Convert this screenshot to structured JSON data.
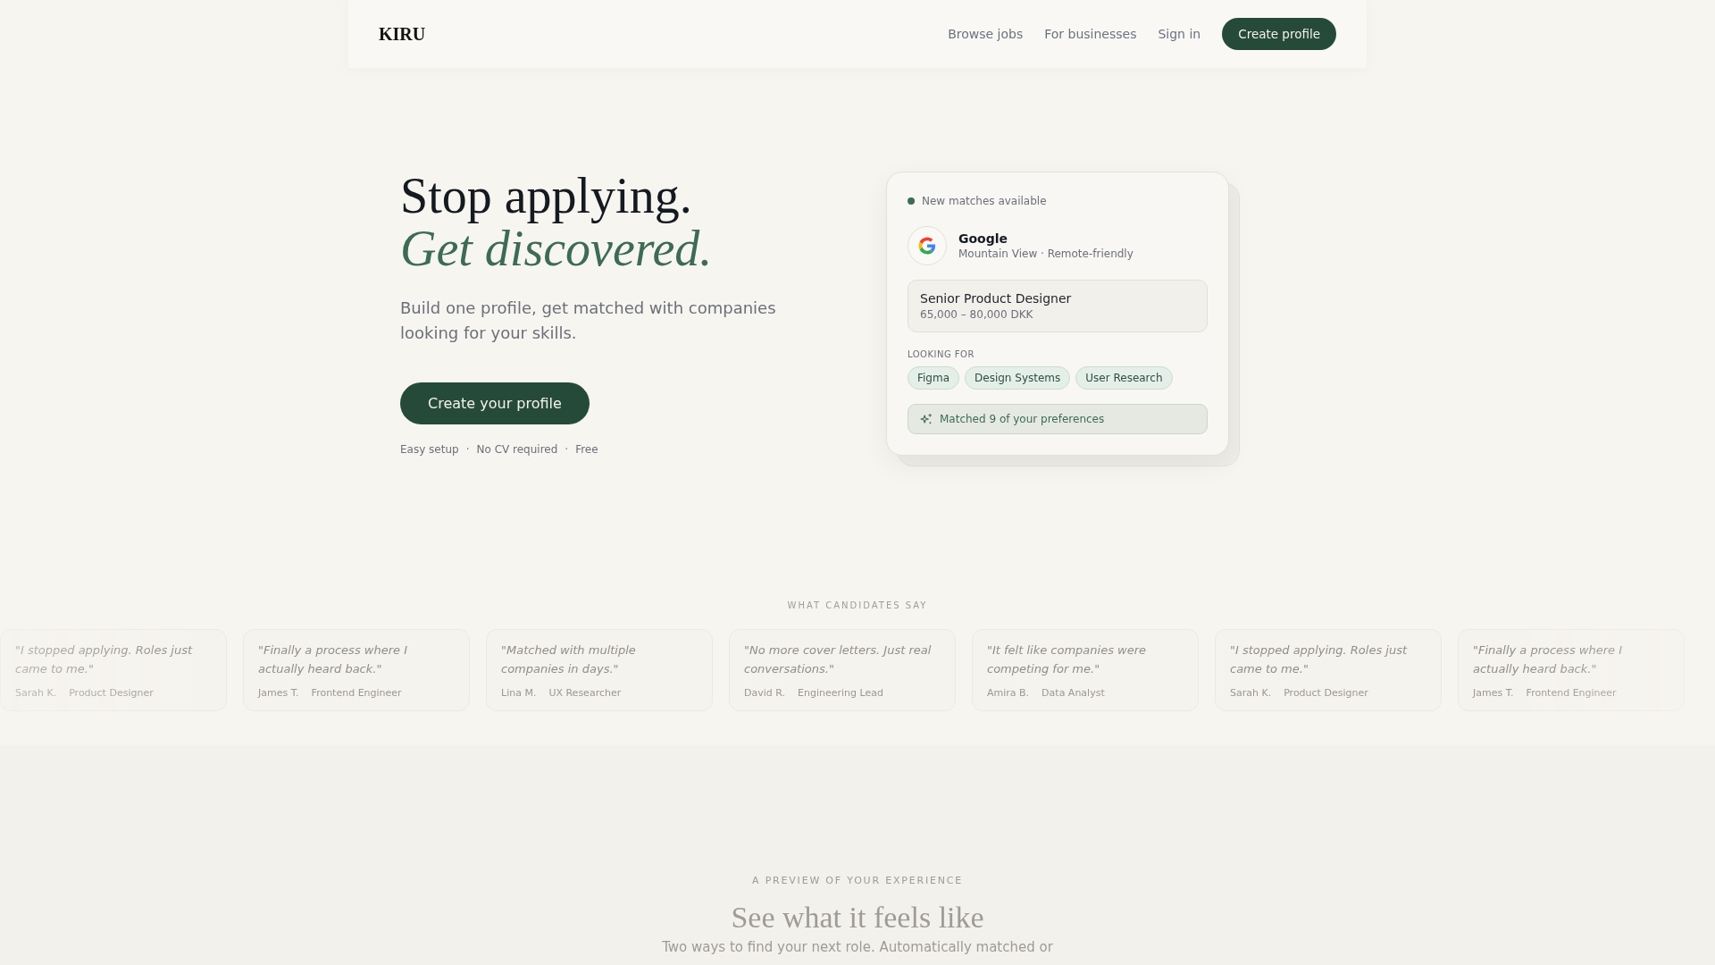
{
  "nav": {
    "logo": "KIRU",
    "links": [
      "Browse jobs",
      "For businesses",
      "Sign in"
    ],
    "cta": "Create profile"
  },
  "hero": {
    "title_line": "Stop applying.",
    "title_accent": "Get discovered.",
    "subtitle": "Build one profile, get matched with companies looking for your skills.",
    "cta": "Create your profile",
    "features": [
      "Easy setup",
      "No CV required",
      "Free"
    ],
    "separator": "·"
  },
  "match_card": {
    "status": "New matches available",
    "company": "Google",
    "location": "Mountain View · Remote-friendly",
    "job_title": "Senior Product Designer",
    "salary": "65,000 – 80,000 DKK",
    "looking_for_label": "LOOKING FOR",
    "tags": [
      "Figma",
      "Design Systems",
      "User Research"
    ],
    "match_summary": "Matched 9 of your preferences"
  },
  "testimonials": {
    "label": "WHAT CANDIDATES SAY",
    "items": [
      {
        "quote": "\"I stopped applying. Roles just came to me.\"",
        "name": "Sarah K.",
        "role": "Product Designer"
      },
      {
        "quote": "\"Finally a process where I actually heard back.\"",
        "name": "James T.",
        "role": "Frontend Engineer"
      },
      {
        "quote": "\"Matched with multiple companies in days.\"",
        "name": "Lina M.",
        "role": "UX Researcher"
      },
      {
        "quote": "\"No more cover letters. Just real conversations.\"",
        "name": "David R.",
        "role": "Engineering Lead"
      },
      {
        "quote": "\"It felt like companies were competing for me.\"",
        "name": "Amira B.",
        "role": "Data Analyst"
      },
      {
        "quote": "\"I stopped applying. Roles just came to me.\"",
        "name": "Sarah K.",
        "role": "Product Designer"
      },
      {
        "quote": "\"Finally a process where I actually heard back.\"",
        "name": "James T.",
        "role": "Frontend Engineer"
      }
    ]
  },
  "preview_section": {
    "eyebrow": "A PREVIEW OF YOUR EXPERIENCE",
    "title": "See what it feels like",
    "subtitle": "Two ways to find your next role. Automatically matched or"
  }
}
